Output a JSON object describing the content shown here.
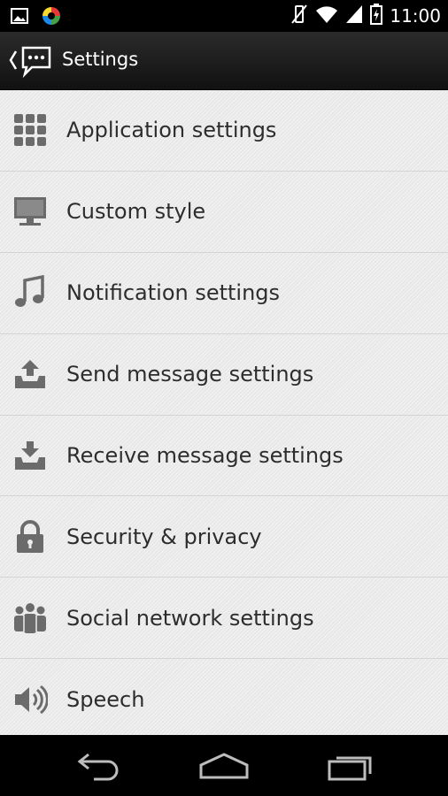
{
  "status_bar": {
    "left_icons": [
      "gallery-icon",
      "app-logo-icon"
    ],
    "right_icons": [
      "vibrate-icon",
      "wifi-icon",
      "signal-icon",
      "battery-icon"
    ],
    "time": "11:00"
  },
  "action_bar": {
    "title": "Settings",
    "back_icon": "chat-bubble-icon"
  },
  "list": {
    "items": [
      {
        "label": "Application settings",
        "icon": "grid-icon"
      },
      {
        "label": "Custom style",
        "icon": "monitor-icon"
      },
      {
        "label": "Notification settings",
        "icon": "music-note-icon"
      },
      {
        "label": "Send message settings",
        "icon": "send-tray-icon"
      },
      {
        "label": "Receive message settings",
        "icon": "receive-tray-icon"
      },
      {
        "label": "Security & privacy",
        "icon": "lock-icon"
      },
      {
        "label": "Social network settings",
        "icon": "people-icon"
      },
      {
        "label": "Speech",
        "icon": "speaker-icon"
      }
    ]
  },
  "nav_bar": {
    "buttons": [
      "back-nav-icon",
      "home-nav-icon",
      "recents-nav-icon"
    ]
  },
  "colors": {
    "status_bar_bg": "#000000",
    "action_bar_bg": "#1e1e1e",
    "list_bg": "#ececec",
    "text": "#2d2d2d",
    "icon": "#6b6b6b"
  }
}
